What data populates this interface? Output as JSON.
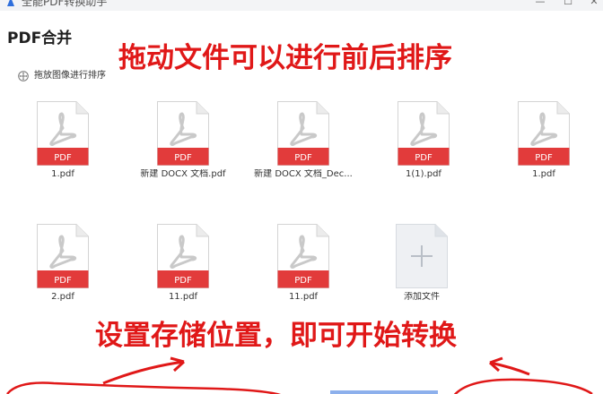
{
  "window": {
    "app_title": "全能PDF转换助手",
    "logo_icon": "app-logo-icon",
    "controls": {
      "minimize": "—",
      "maximize": "☐",
      "close": "✕"
    }
  },
  "page": {
    "title": "PDF合并",
    "hint": "拖放图像进行排序",
    "hint_icon": "drag-move-icon"
  },
  "files": [
    {
      "name": "1.pdf",
      "badge": "PDF"
    },
    {
      "name": "新建 DOCX 文档.pdf",
      "badge": "PDF"
    },
    {
      "name": "新建 DOCX 文档_Dec...",
      "badge": "PDF"
    },
    {
      "name": "1(1).pdf",
      "badge": "PDF"
    },
    {
      "name": "1.pdf",
      "badge": "PDF"
    },
    {
      "name": "2.pdf",
      "badge": "PDF"
    },
    {
      "name": "11.pdf",
      "badge": "PDF"
    },
    {
      "name": "11.pdf",
      "badge": "PDF"
    }
  ],
  "add_file": {
    "label": "添加文件",
    "icon": "plus-icon"
  },
  "annotations": {
    "top": "拖动文件可以进行前后排序",
    "bottom": "设置存储位置，即可开始转换"
  },
  "colors": {
    "pdf_red": "#e23b3b",
    "annotation_red": "#e01818",
    "acrobat_grey": "#c9c9c9",
    "titlebar": "#f3f4f6"
  }
}
